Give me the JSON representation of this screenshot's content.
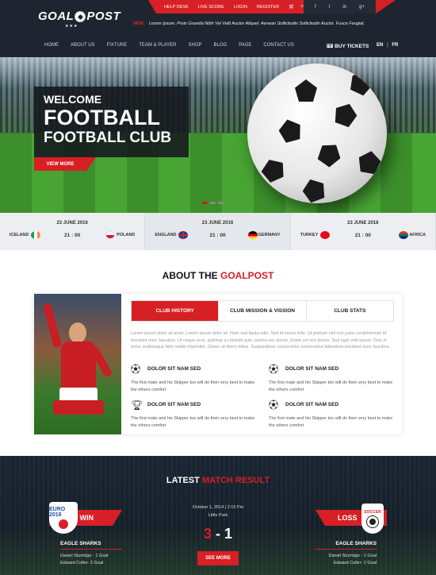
{
  "header": {
    "logo_left": "GOAL",
    "logo_right": "POST",
    "logo_stars": "★★★",
    "top_links": [
      "HELP DESK",
      "LIVE SCORE",
      "LOGIN",
      "REGISTER"
    ],
    "ticker_label": "NEW:",
    "ticker_text": "Lorem Ipsum. Proin Gravida Nibh Vel Velit Auctor Aliquet. Aenean Sollicitudin Sollicitudin Auctor. Fusce Feugiat.",
    "nav": [
      "HOME",
      "ABOUT US",
      "FIXTURE",
      "TEAM & PLAYER",
      "SHOP",
      "BLOG",
      "PAGE",
      "CONTACT US"
    ],
    "buy_tickets": "BUY TICKETS",
    "lang_en": "EN",
    "lang_sep": "|",
    "lang_fr": "FR",
    "accent": "#d71f26"
  },
  "hero": {
    "welcome": "WELCOME",
    "line1": "FOOTBALL",
    "line2": "FOOTBALL CLUB",
    "cta": "VIEW MORE"
  },
  "matches": [
    {
      "date": "23 JUNE 2016",
      "team1": "ICELAND",
      "time": "21 : 00",
      "team2": "POLAND"
    },
    {
      "date": "23 JUNE 2016",
      "team1": "ENGLAND",
      "time": "21 : 00",
      "team2": "GERMANY"
    },
    {
      "date": "23 JUNE 2016",
      "team1": "TURKEY",
      "time": "21 : 00",
      "team2": "AFRICA"
    }
  ],
  "about": {
    "title": "ABOUT THE",
    "title_red": "GOALPOST",
    "tabs": [
      "CLUB HISTORY",
      "CLUB MISSION & VISSION",
      "CLUB STATS"
    ],
    "text": "Lorem ipsum dolor sit amet, Lorem ipsum dolor sit. Nam sed ligula odio. Sed id metus felis. Ut pretium nisl non justo condimentum id tincidunt nunc faucibus. Ut neque eros, pulvinar eu blandit quis, lacinia nec ipsum. Etiam vel orci ipsum. Sed eget velit ipsum. Duis in tortor scelerisque felis mattis imperdiet. Donec at libero tellus. Suspendisse consectetur consectetur bibendum.tincidunt nunc faucibus.",
    "features": [
      {
        "title": "DOLOR SIT NAM SED",
        "text": "The first mate and his Skipper too will do their very best to make the others comfort"
      },
      {
        "title": "DOLOR SIT NAM SED",
        "text": "The first mate and his Skipper too will do their very best to make the others comfort"
      },
      {
        "title": "DOLOR SIT NAM SED",
        "text": "The first mate and his Skipper too will do their very best to make the others comfort"
      },
      {
        "title": "DOLOR SIT NAM SED",
        "text": "The first mate and his Skipper too will do their very best to make the others comfort"
      }
    ]
  },
  "latest": {
    "title": "LATEST",
    "title_red": "MATCH RESULT",
    "date": "October 1, 2014 | 2:15 Pm",
    "place": "Little Park",
    "score_home": "3",
    "score_sep": "-",
    "score_away": "1",
    "see_more": "SEE MORE",
    "win": "WIN",
    "loss": "LOSS",
    "euro_logo": "EURO 2016",
    "soccer_logo": "SOCCER",
    "left_team": {
      "name": "EAGLE SHARKS",
      "scorers": [
        "Daniel Sturridge - 1 Goal",
        "Edward Coller- 2 Goal"
      ]
    },
    "right_team": {
      "name": "EAGLE SHARKS",
      "scorers": [
        "Daniel Sturridge - 1 Goal",
        "Edward Coller- 2 Goal"
      ]
    }
  }
}
